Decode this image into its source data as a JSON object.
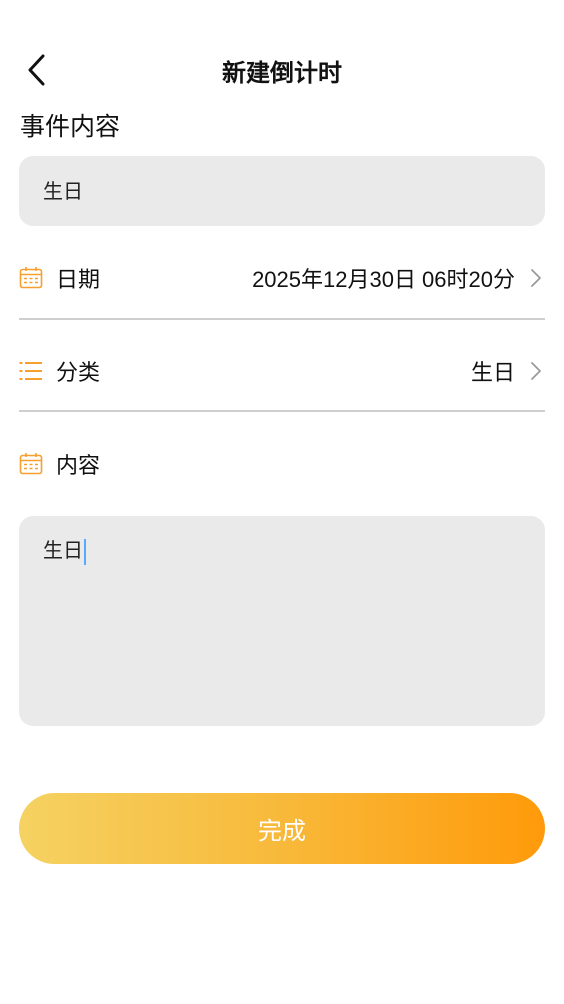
{
  "header": {
    "title": "新建倒计时",
    "back_icon": "chevron-left-icon"
  },
  "event": {
    "label": "事件内容",
    "value": "生日"
  },
  "date_row": {
    "icon": "calendar-icon",
    "label": "日期",
    "value": "2025年12月30日 06时20分"
  },
  "category_row": {
    "icon": "list-icon",
    "label": "分类",
    "value": "生日"
  },
  "content_row": {
    "icon": "calendar-icon",
    "label": "内容"
  },
  "content": {
    "value": "生日"
  },
  "submit": {
    "label": "完成"
  },
  "colors": {
    "accent": "#ff9a0a",
    "icon_orange": "#f7a030",
    "input_bg": "#eaeaea",
    "gradient_start": "#f5d262",
    "gradient_end": "#ff9a0a",
    "caret": "#5aa9ff"
  }
}
